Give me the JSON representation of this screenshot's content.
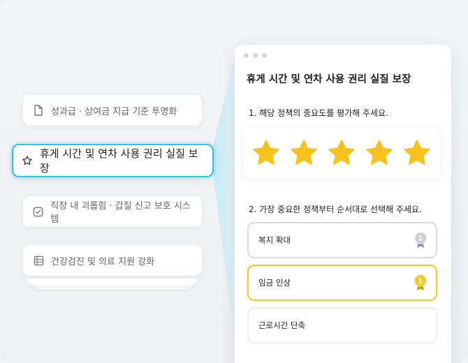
{
  "left_list": {
    "items": [
      {
        "label": "성과급 · 상여금 지급 기준 투명화",
        "icon": "document-icon"
      },
      {
        "label": "휴게 시간 및 연차 사용 권리 실질 보장",
        "icon": "star-outline-icon",
        "selected": true
      },
      {
        "label": "직장 내 괴롭힘 · 갑질 신고 보호 시스템",
        "icon": "checkbox-icon"
      },
      {
        "label": "건강검진 및 의료 지원 강화",
        "icon": "list-icon"
      }
    ]
  },
  "panel": {
    "title": "휴게 시간 및 연차 사용 권리 실질 보장",
    "question1": "1. 해당 정책의 중요도를 평가해 주세요.",
    "rating": {
      "value": 5,
      "max": 5
    },
    "question2": "2. 가장 중요한 정책부터 순서대로 선택해 주세요.",
    "options": [
      {
        "label": "복지 확대",
        "rank": "2"
      },
      {
        "label": "임금 인상",
        "rank": "1"
      },
      {
        "label": "근로시간 단축",
        "rank": ""
      }
    ]
  },
  "colors": {
    "accent_cyan": "#2fc3e6",
    "star_yellow": "#f7c21e",
    "gold_medal": "#f2c92c",
    "silver_medal": "#c9ccd2"
  }
}
